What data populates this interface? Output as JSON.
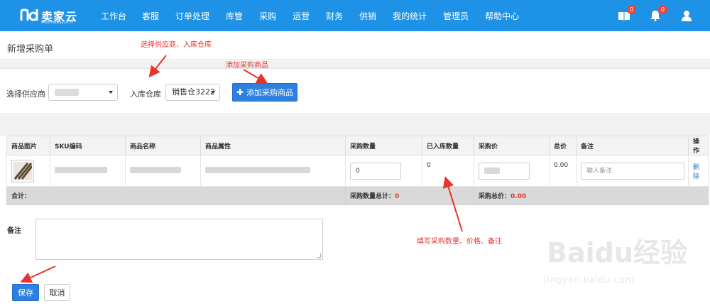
{
  "brand": {
    "name": "卖家云",
    "sub": "www.maijiayun.cn"
  },
  "nav": [
    "工作台",
    "客服",
    "订单处理",
    "库管",
    "采购",
    "运营",
    "财务",
    "供销",
    "我的统计",
    "管理员",
    "帮助中心"
  ],
  "top_icons": [
    {
      "icon": "book-icon",
      "badge": "0"
    },
    {
      "icon": "bell-icon",
      "badge": "0"
    },
    {
      "icon": "user-icon"
    }
  ],
  "page_title": "新增采购单",
  "form": {
    "supplier_label": "选择供应商",
    "warehouse_label": "入库仓库",
    "warehouse_value": "销售仓3222",
    "add_button": "添加采购商品"
  },
  "table": {
    "headers": [
      "商品图片",
      "SKU编码",
      "商品名称",
      "商品属性",
      "采购数量",
      "已入库数量",
      "采购价",
      "总价",
      "备注",
      "操作"
    ],
    "row": {
      "qty": "0",
      "received": "0",
      "total": "0.00",
      "remark_placeholder": "输入备注",
      "action": "删除"
    },
    "total_row": {
      "label": "合计：",
      "qty_label": "采购数量总计：",
      "qty_value": "0",
      "price_label": "采购总价：",
      "price_value": "0.00"
    }
  },
  "remark_label": "备注",
  "buttons": {
    "save": "保存",
    "cancel": "取消"
  },
  "annotations": {
    "a1": "选择供应商、入库仓库",
    "a2": "添加采购商品",
    "a3": "填写采购数量、价格、备注"
  },
  "watermark": {
    "text": "Baidu经验",
    "url": "jingyan.baidu.com"
  },
  "colors": {
    "nav_bg": "#1e92e6",
    "primary": "#2d7fe0",
    "annotation": "#e8342b",
    "total_row_bg": "#d9d9d9"
  }
}
